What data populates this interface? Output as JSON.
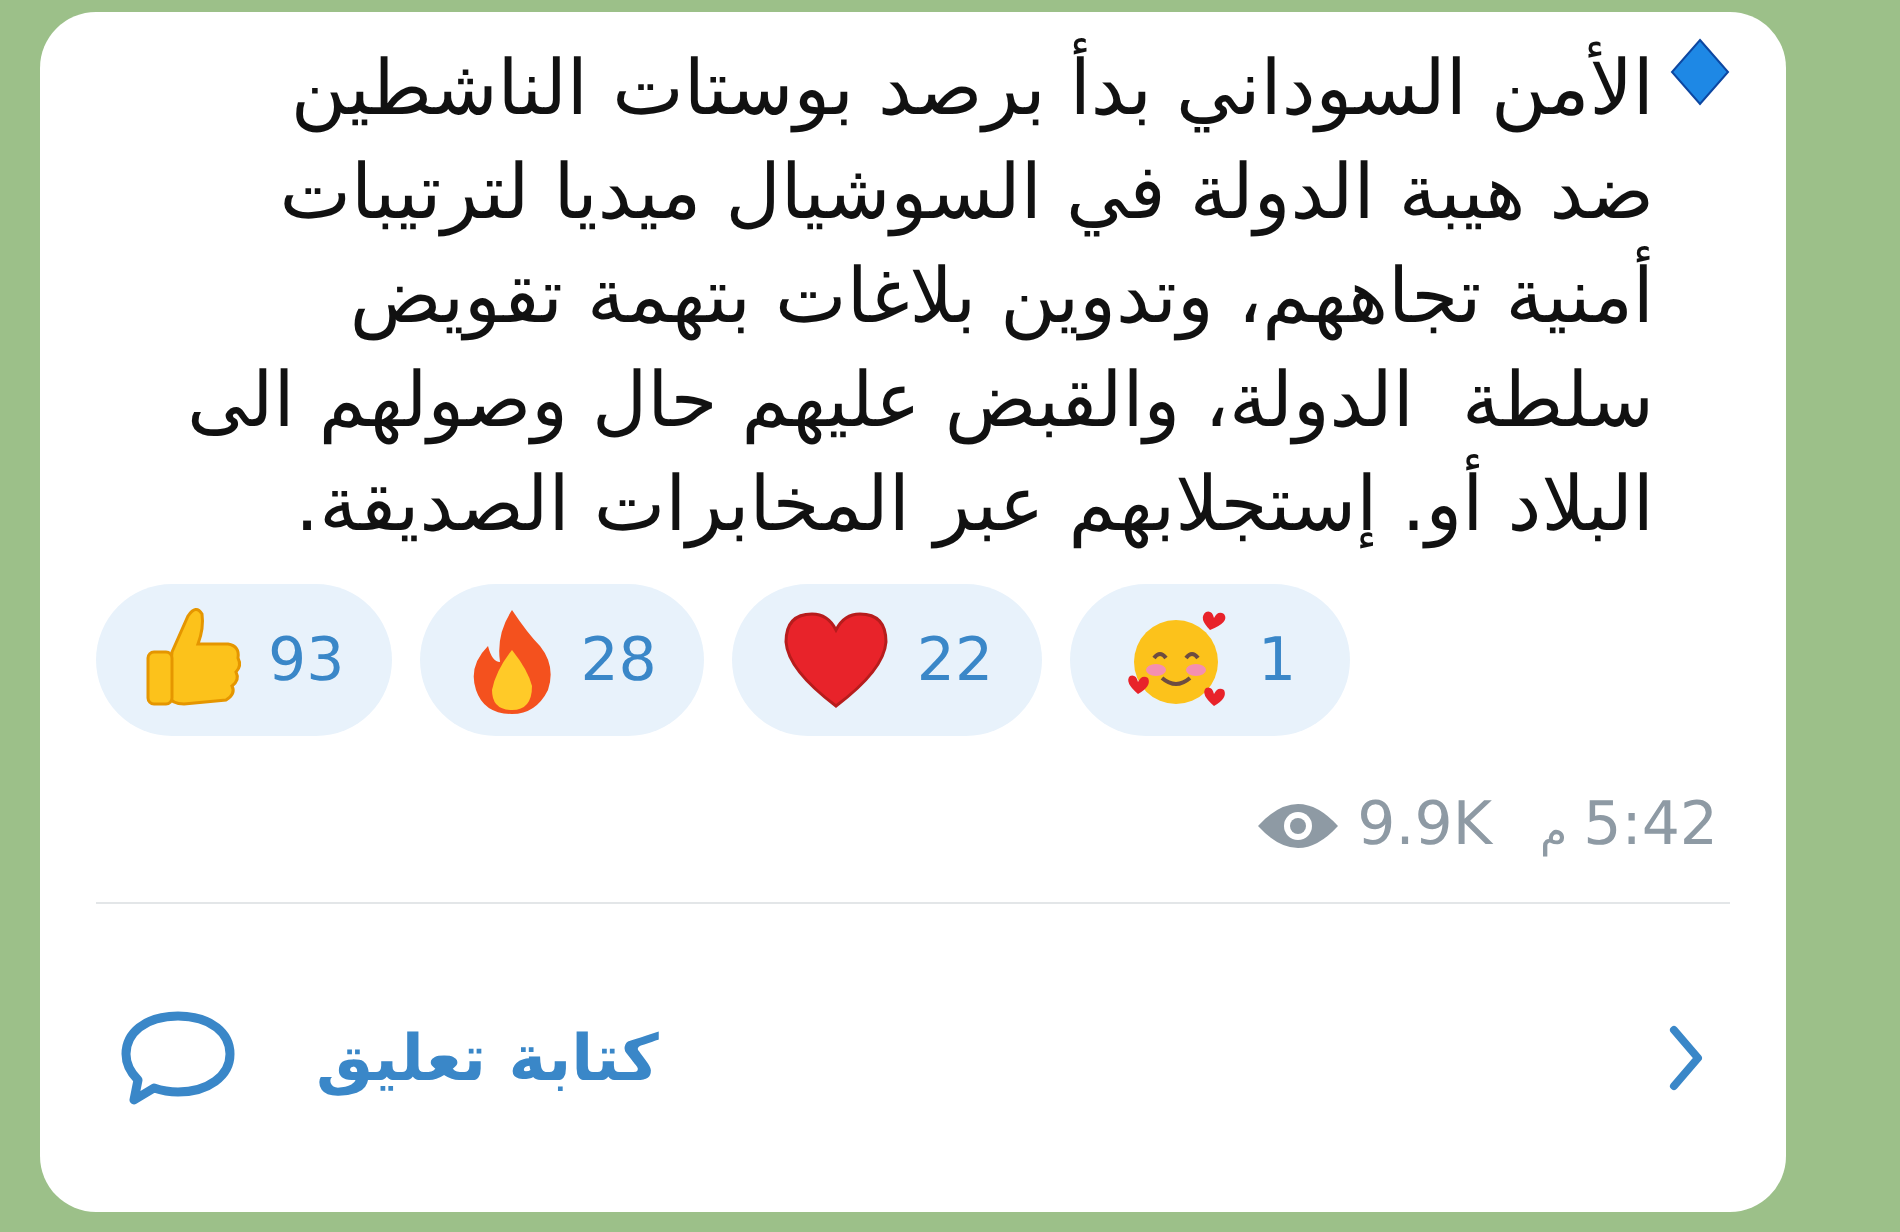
{
  "message": {
    "text": "الأمن السوداني بدأ برصد بوستات الناشطين\nضد هيبة الدولة في السوشيال ميديا لترتيبات\nأمنية تجاههم، وتدوين بلاغات بتهمة تقويض\nسلطة  الدولة، والقبض عليهم حال وصولهم الى\nالبلاد أو. إستجلابهم عبر المخابرات الصديقة.",
    "reactions": [
      {
        "kind": "smiling-hearts",
        "count": "1"
      },
      {
        "kind": "heart",
        "count": "22"
      },
      {
        "kind": "fire",
        "count": "28"
      },
      {
        "kind": "thumbs",
        "count": "93"
      }
    ],
    "views": "9.9K",
    "period": "م",
    "time": "5:42"
  },
  "comment_bar": {
    "label": "كتابة تعليق"
  }
}
